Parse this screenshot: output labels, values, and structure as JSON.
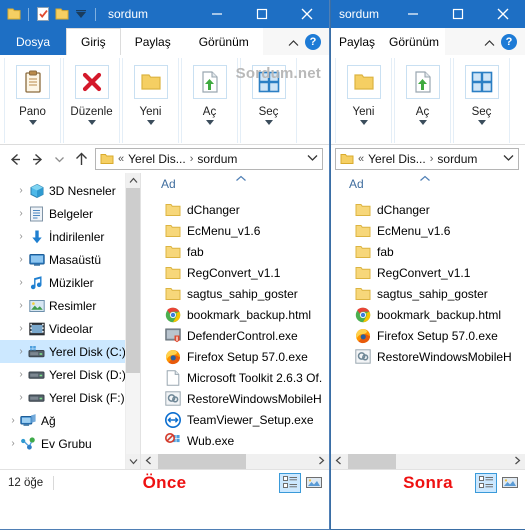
{
  "left_window": {
    "title": "sordum",
    "quick_access": [
      {
        "name": "folder-icon",
        "label": "Klasör"
      },
      {
        "name": "properties-icon",
        "label": "Özellikler"
      },
      {
        "name": "new-folder-icon",
        "label": "Yeni klasör"
      },
      {
        "name": "customize-qat-icon",
        "label": "Hızlı Erişim Araç Çubuğunu Özelleştir"
      }
    ],
    "window_buttons": {
      "minimize": "—",
      "maximize": "□",
      "close": "✕"
    },
    "tabs": [
      {
        "label": "Dosya",
        "type": "file"
      },
      {
        "label": "Giriş",
        "type": "active"
      },
      {
        "label": "Paylaş",
        "type": "normal"
      },
      {
        "label": "Görünüm",
        "type": "normal"
      }
    ],
    "ribbon_help": "?",
    "ribbon_groups": [
      {
        "label": "Pano",
        "icon": "clipboard-icon"
      },
      {
        "label": "Düzenle",
        "icon": "delete-x-icon"
      },
      {
        "label": "Yeni",
        "icon": "new-folder-icon"
      },
      {
        "label": "Aç",
        "icon": "open-file-icon"
      },
      {
        "label": "Seç",
        "icon": "select-grid-icon"
      }
    ],
    "watermark": "Sordum.net",
    "nav_buttons": [
      {
        "name": "back-button",
        "glyph": "←"
      },
      {
        "name": "forward-button",
        "glyph": "→"
      },
      {
        "name": "recent-locations-button",
        "glyph": "⌄"
      },
      {
        "name": "up-button",
        "glyph": "↑"
      }
    ],
    "address": {
      "icon": "folder-icon",
      "prefix": "«",
      "crumbs": [
        "Yerel Dis...",
        "sordum"
      ],
      "separator": "›",
      "dropdown": "⌄"
    },
    "tree_items": [
      {
        "label": "3D Nesneler",
        "icon": "3d-objects-icon",
        "selected": false,
        "indent": 0
      },
      {
        "label": "Belgeler",
        "icon": "documents-icon",
        "selected": false,
        "indent": 0
      },
      {
        "label": "İndirilenler",
        "icon": "downloads-icon",
        "selected": false,
        "indent": 0
      },
      {
        "label": "Masaüstü",
        "icon": "desktop-icon",
        "selected": false,
        "indent": 0
      },
      {
        "label": "Müzikler",
        "icon": "music-icon",
        "selected": false,
        "indent": 0
      },
      {
        "label": "Resimler",
        "icon": "pictures-icon",
        "selected": false,
        "indent": 0
      },
      {
        "label": "Videolar",
        "icon": "videos-icon",
        "selected": false,
        "indent": 0
      },
      {
        "label": "Yerel Disk (C:)",
        "icon": "system-drive-icon",
        "selected": true,
        "indent": 0
      },
      {
        "label": "Yerel Disk (D:)",
        "icon": "drive-icon",
        "selected": false,
        "indent": 0
      },
      {
        "label": "Yerel Disk (F:)",
        "icon": "drive-icon",
        "selected": false,
        "indent": 0
      },
      {
        "label": "Ağ",
        "icon": "network-icon",
        "selected": false,
        "indent": 1
      },
      {
        "label": "Ev Grubu",
        "icon": "homegroup-icon",
        "selected": false,
        "indent": 1
      }
    ],
    "column_header": "Ad",
    "sort_indicator": "⌃",
    "files": [
      {
        "name": "dChanger",
        "icon": "folder-icon"
      },
      {
        "name": "EcMenu_v1.6",
        "icon": "folder-icon"
      },
      {
        "name": "fab",
        "icon": "folder-icon"
      },
      {
        "name": "RegConvert_v1.1",
        "icon": "folder-icon"
      },
      {
        "name": "sagtus_sahip_goster",
        "icon": "folder-icon"
      },
      {
        "name": "bookmark_backup.html",
        "icon": "chrome-icon"
      },
      {
        "name": "DefenderControl.exe",
        "icon": "defender-icon"
      },
      {
        "name": "Firefox Setup 57.0.exe",
        "icon": "firefox-icon"
      },
      {
        "name": "Microsoft Toolkit 2.6.3 Of.",
        "icon": "blank-file-icon"
      },
      {
        "name": "RestoreWindowsMobileH",
        "icon": "restore-icon"
      },
      {
        "name": "TeamViewer_Setup.exe",
        "icon": "teamviewer-icon"
      },
      {
        "name": "Wub.exe",
        "icon": "wub-icon"
      }
    ],
    "status_text": "12 öğe",
    "caption": "Önce",
    "view_buttons": [
      {
        "name": "details-view-button",
        "icon": "details-icon",
        "active": true
      },
      {
        "name": "large-icons-view-button",
        "icon": "large-icons-icon",
        "active": false
      }
    ]
  },
  "right_window": {
    "title": "sordum",
    "window_buttons": {
      "minimize": "—",
      "maximize": "□",
      "close": "✕"
    },
    "tabs": [
      {
        "label": "Paylaş",
        "type": "normal"
      },
      {
        "label": "Görünüm",
        "type": "normal"
      }
    ],
    "ribbon_help": "?",
    "ribbon_groups": [
      {
        "label": "Yeni",
        "icon": "new-folder-icon"
      },
      {
        "label": "Aç",
        "icon": "open-file-icon"
      },
      {
        "label": "Seç",
        "icon": "select-grid-icon"
      }
    ],
    "address": {
      "icon": "folder-icon",
      "prefix": "«",
      "crumbs": [
        "Yerel Dis...",
        "sordum"
      ],
      "separator": "›",
      "dropdown": "⌄"
    },
    "column_header": "Ad",
    "sort_indicator": "⌃",
    "files": [
      {
        "name": "dChanger",
        "icon": "folder-icon"
      },
      {
        "name": "EcMenu_v1.6",
        "icon": "folder-icon"
      },
      {
        "name": "fab",
        "icon": "folder-icon"
      },
      {
        "name": "RegConvert_v1.1",
        "icon": "folder-icon"
      },
      {
        "name": "sagtus_sahip_goster",
        "icon": "folder-icon"
      },
      {
        "name": "bookmark_backup.html",
        "icon": "chrome-icon"
      },
      {
        "name": "Firefox Setup 57.0.exe",
        "icon": "firefox-icon"
      },
      {
        "name": "RestoreWindowsMobileH",
        "icon": "restore-icon"
      }
    ],
    "caption": "Sonra",
    "view_buttons": [
      {
        "name": "details-view-button",
        "icon": "details-icon",
        "active": true
      },
      {
        "name": "large-icons-view-button",
        "icon": "large-icons-icon",
        "active": false
      }
    ]
  },
  "colors": {
    "titlebar": "#1e6fc4",
    "selection": "#cce8ff",
    "caption_red": "#ee1111",
    "watermark_gray": "#b9b9b9",
    "crumb_blue": "#3f6d9e"
  }
}
